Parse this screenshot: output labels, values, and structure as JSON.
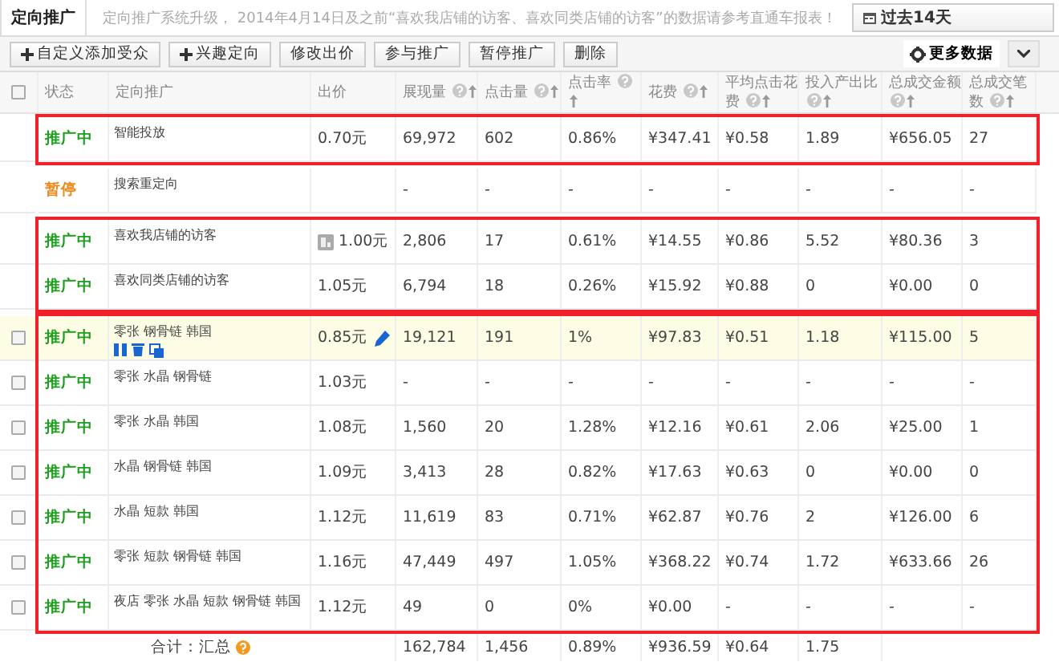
{
  "tabs": [
    {
      "label": "定向推广",
      "selected": true
    }
  ],
  "notice": "定向推广系统升级， 2014年4月14日及之前“喜欢我店铺的访客、喜欢同类店铺的访客”的数据请参考直通车报表！",
  "date_range": "过去14天",
  "toolbar": [
    {
      "label": "自定义添加受众",
      "kind": "add"
    },
    {
      "label": "兴趣定向",
      "kind": "add"
    },
    {
      "label": "修改出价",
      "kind": "plain"
    },
    {
      "label": "参与推广",
      "kind": "plain"
    },
    {
      "label": "暂停推广",
      "kind": "plain"
    },
    {
      "label": "删除",
      "kind": "plain"
    }
  ],
  "more_data": "更多数据",
  "table": {
    "header_checkbox": {
      "checked": false
    },
    "columns": [
      {
        "label": "状态",
        "help": false,
        "sortable": false
      },
      {
        "label": "定向推广",
        "help": false,
        "sortable": false
      },
      {
        "label": "出价",
        "help": false,
        "sortable": false
      },
      {
        "label": "展现量",
        "help": true,
        "sortable": true
      },
      {
        "label": "点击量",
        "help": true,
        "sortable": true
      },
      {
        "label": "点击率",
        "help": true,
        "sortable": true
      },
      {
        "label": "花费",
        "help": true,
        "sortable": true
      },
      {
        "label": "平均点击花费",
        "help": true,
        "sortable": true
      },
      {
        "label": "投入产出比",
        "help": true,
        "sortable": true
      },
      {
        "label": "总成交金额",
        "help": true,
        "sortable": true
      },
      {
        "label": "总成交笔数",
        "help": true,
        "sortable": true
      }
    ],
    "row_groups": [
      {
        "outlined": true,
        "rows": [
          {
            "status": "推广中",
            "color": "#1f9e1f",
            "name": "智能投放",
            "bid": "0.70元",
            "values": [
              "69,972",
              "602",
              "0.86%",
              "¥347.41",
              "¥0.58",
              "1.89",
              "¥656.05",
              "27"
            ],
            "selected": false
          }
        ]
      },
      {
        "outlined": false,
        "rows": [
          {
            "status": "暂停",
            "color": "#f0891b",
            "name": "搜索重定向",
            "values": [
              "-",
              "-",
              "-",
              "-",
              "-",
              "-",
              "-",
              "-"
            ],
            "selected": false
          }
        ]
      },
      {
        "outlined": true,
        "rows": [
          {
            "status": "推广中",
            "color": "#1f9e1f",
            "name": "喜欢我店铺的访客",
            "bid": "1.00元",
            "bid_badge": true,
            "values": [
              "2,806",
              "17",
              "0.61%",
              "¥14.55",
              "¥0.86",
              "5.52",
              "¥80.36",
              "3"
            ],
            "selected": false
          },
          {
            "status": "推广中",
            "color": "#1f9e1f",
            "name": "喜欢同类店铺的访客",
            "bid": "1.05元",
            "values": [
              "6,794",
              "18",
              "0.26%",
              "¥15.92",
              "¥0.88",
              "0",
              "¥0.00",
              "0"
            ],
            "selected": false
          }
        ]
      },
      {
        "outlined": true,
        "rows": [
          {
            "checked": false,
            "status": "推广中",
            "color": "#1f9e1f",
            "name": "零张 钢骨链 韩国",
            "bid": "0.85元",
            "values": [
              "19,121",
              "191",
              "1%",
              "¥97.83",
              "¥0.51",
              "1.18",
              "¥115.00",
              "5"
            ],
            "selected": true
          },
          {
            "checked": false,
            "status": "推广中",
            "color": "#1f9e1f",
            "name": "零张 水晶 钢骨链",
            "bid": "1.03元",
            "values": [
              "-",
              "-",
              "-",
              "-",
              "-",
              "-",
              "-",
              "-"
            ],
            "selected": false
          },
          {
            "checked": false,
            "status": "推广中",
            "color": "#1f9e1f",
            "name": "零张 水晶 韩国",
            "bid": "1.08元",
            "values": [
              "1,560",
              "20",
              "1.28%",
              "¥12.16",
              "¥0.61",
              "2.06",
              "¥25.00",
              "1"
            ],
            "selected": false
          },
          {
            "checked": false,
            "status": "推广中",
            "color": "#1f9e1f",
            "name": "水晶 钢骨链 韩国",
            "bid": "1.09元",
            "values": [
              "3,413",
              "28",
              "0.82%",
              "¥17.63",
              "¥0.63",
              "0",
              "¥0.00",
              "0"
            ],
            "selected": false
          },
          {
            "checked": false,
            "status": "推广中",
            "color": "#1f9e1f",
            "name": "水晶 短款 韩国",
            "bid": "1.12元",
            "values": [
              "11,619",
              "83",
              "0.71%",
              "¥62.87",
              "¥0.76",
              "2",
              "¥126.00",
              "6"
            ],
            "selected": false
          },
          {
            "checked": false,
            "status": "推广中",
            "color": "#1f9e1f",
            "name": "零张 短款 钢骨链 韩国",
            "bid": "1.16元",
            "values": [
              "47,449",
              "497",
              "1.05%",
              "¥368.22",
              "¥0.74",
              "1.72",
              "¥633.66",
              "26"
            ],
            "selected": false
          },
          {
            "checked": false,
            "status": "推广中",
            "color": "#1f9e1f",
            "name": "夜店 零张 水晶 短款 钢骨链 韩国",
            "bid": "1.12元",
            "values": [
              "49",
              "0",
              "0%",
              "¥0.00",
              "-",
              "-",
              "-",
              "-"
            ],
            "selected": false
          }
        ]
      }
    ],
    "total": {
      "label": "合计：汇总",
      "values": [
        "162,784",
        "1,456",
        "0.89%",
        "¥936.59",
        "¥0.64",
        "1.75"
      ]
    }
  }
}
